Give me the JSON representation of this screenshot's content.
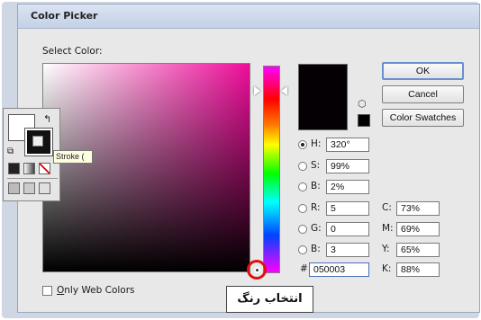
{
  "dialog": {
    "title": "Color Picker",
    "select_label": "Select Color:"
  },
  "buttons": {
    "ok": "OK",
    "cancel": "Cancel",
    "swatches": "Color Swatches"
  },
  "hsb": {
    "h_label": "H:",
    "h_value": "320°",
    "s_label": "S:",
    "s_value": "99%",
    "b_label": "B:",
    "b_value": "2%"
  },
  "rgb": {
    "r_label": "R:",
    "r_value": "5",
    "g_label": "G:",
    "g_value": "0",
    "b_label": "B:",
    "b_value": "3"
  },
  "cmyk": {
    "c_label": "C:",
    "c_value": "73%",
    "m_label": "M:",
    "m_value": "69%",
    "y_label": "Y:",
    "y_value": "65%",
    "k_label": "K:",
    "k_value": "88%"
  },
  "hex": {
    "label": "#",
    "value": "050003"
  },
  "web_colors": {
    "underlined": "O",
    "rest": "nly Web Colors",
    "checked": false
  },
  "tooltip": "Stroke (",
  "callout": "انتخاب رنگ",
  "colors": {
    "current": "#050003",
    "accent_marker": "#e01010"
  }
}
